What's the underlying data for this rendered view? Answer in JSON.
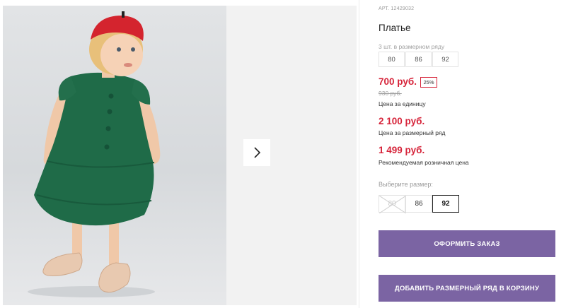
{
  "gallery": {
    "photo_alt_icon": "child-in-green-dress",
    "next_icon": "chevron-right-icon"
  },
  "product": {
    "article": "АРТ. 12429032",
    "title": "Платье",
    "range_label": "3 шт. в размерном ряду",
    "range_sizes": [
      "80",
      "86",
      "92"
    ],
    "price": "700 руб.",
    "discount": "25%",
    "old_price": "930 руб.",
    "price_caption": "Цена за единицу",
    "range_price": "2 100 руб.",
    "range_price_caption": "Цена за размерный ряд",
    "retail_price": "1 499 руб.",
    "retail_price_caption": "Рекомендуемая розничная цена",
    "choose_size_label": "Выберите размер:",
    "size_options": [
      {
        "label": "80",
        "state": "unavailable"
      },
      {
        "label": "86",
        "state": "available"
      },
      {
        "label": "92",
        "state": "selected"
      }
    ]
  },
  "actions": {
    "order_label": "ОФОРМИТЬ ЗАКАЗ",
    "add_range_label": "ДОБАВИТЬ РАЗМЕРНЫЙ РЯД В КОРЗИНУ"
  },
  "colors": {
    "accent_red": "#d6243a",
    "button_purple": "#7b64a3",
    "dress_green": "#1f6b48"
  }
}
